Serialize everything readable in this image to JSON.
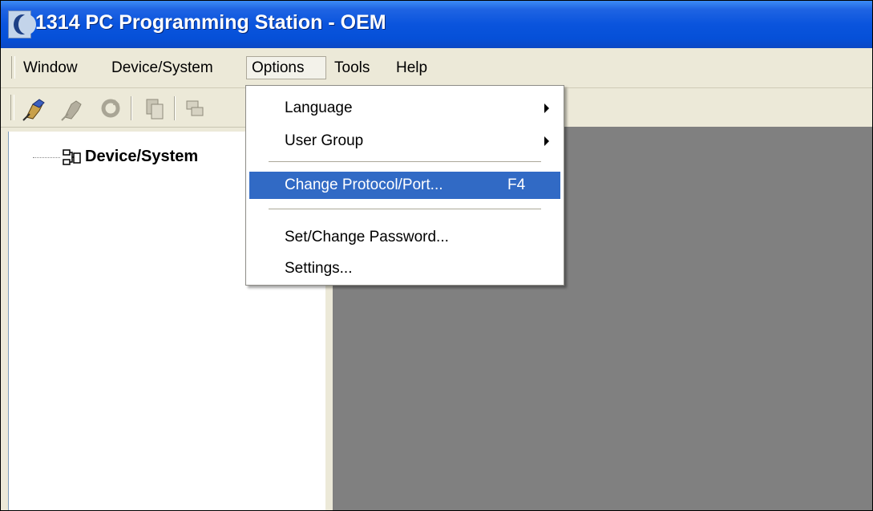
{
  "window": {
    "title": "1314 PC Programming Station - OEM"
  },
  "menubar": {
    "items": [
      {
        "label": "Window"
      },
      {
        "label": "Device/System"
      },
      {
        "label": "Options"
      },
      {
        "label": "Tools"
      },
      {
        "label": "Help"
      }
    ],
    "open_menu": "Options"
  },
  "toolbar": {
    "buttons": [
      "connect-icon",
      "disconnect-icon",
      "refresh-icon",
      "copy-icon",
      "window-icon"
    ]
  },
  "tree": {
    "root": {
      "label": "Device/System",
      "icon": "network-icon"
    }
  },
  "options_menu": {
    "items": [
      {
        "label": "Language",
        "submenu": true
      },
      {
        "label": "User Group",
        "submenu": true
      },
      {
        "label": "Change Protocol/Port...",
        "shortcut": "F4",
        "highlighted": true
      },
      {
        "label": "Set/Change Password..."
      },
      {
        "label": "Settings..."
      }
    ]
  },
  "colors": {
    "titlebar": "#0a54dd",
    "menu_highlight": "#316ac5",
    "workspace": "#808080",
    "chrome": "#ece9d8"
  }
}
